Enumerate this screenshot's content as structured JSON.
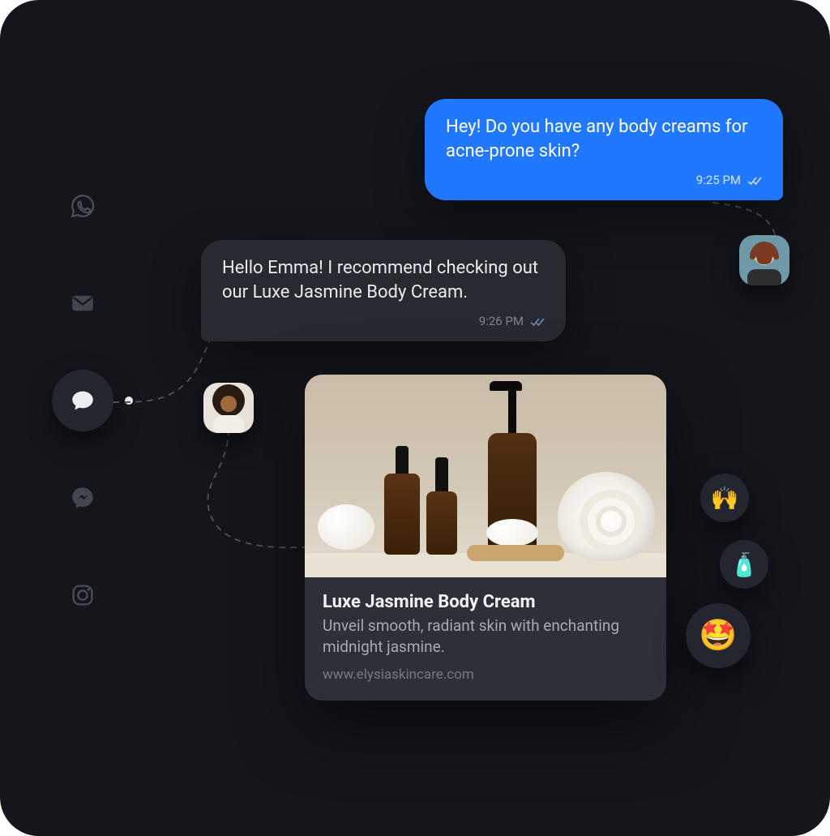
{
  "channels": [
    {
      "id": "whatsapp",
      "icon": "whatsapp-icon",
      "active": false
    },
    {
      "id": "email",
      "icon": "mail-icon",
      "active": false
    },
    {
      "id": "chat",
      "icon": "chat-icon",
      "active": true
    },
    {
      "id": "messenger",
      "icon": "messenger-icon",
      "active": false
    },
    {
      "id": "instagram",
      "icon": "instagram-icon",
      "active": false
    }
  ],
  "messages": {
    "user": {
      "text": "Hey! Do you have any body creams for acne-prone skin?",
      "time": "9:25 PM",
      "status": "read"
    },
    "agent": {
      "text": "Hello Emma! I recommend checking out our Luxe Jasmine Body Cream.",
      "time": "9:26 PM",
      "status": "read"
    }
  },
  "product_card": {
    "title": "Luxe Jasmine Body Cream",
    "description": "Unveil smooth, radiant skin with enchanting midnight jasmine.",
    "domain": "www.elysiaskincare.com"
  },
  "reactions": [
    {
      "emoji": "🙌",
      "size": "small"
    },
    {
      "emoji": "🧴",
      "size": "small"
    },
    {
      "emoji": "🤩",
      "size": "big"
    }
  ],
  "colors": {
    "user_bubble": "#1f78ff",
    "agent_bubble": "#272a31",
    "background": "#14161c"
  }
}
